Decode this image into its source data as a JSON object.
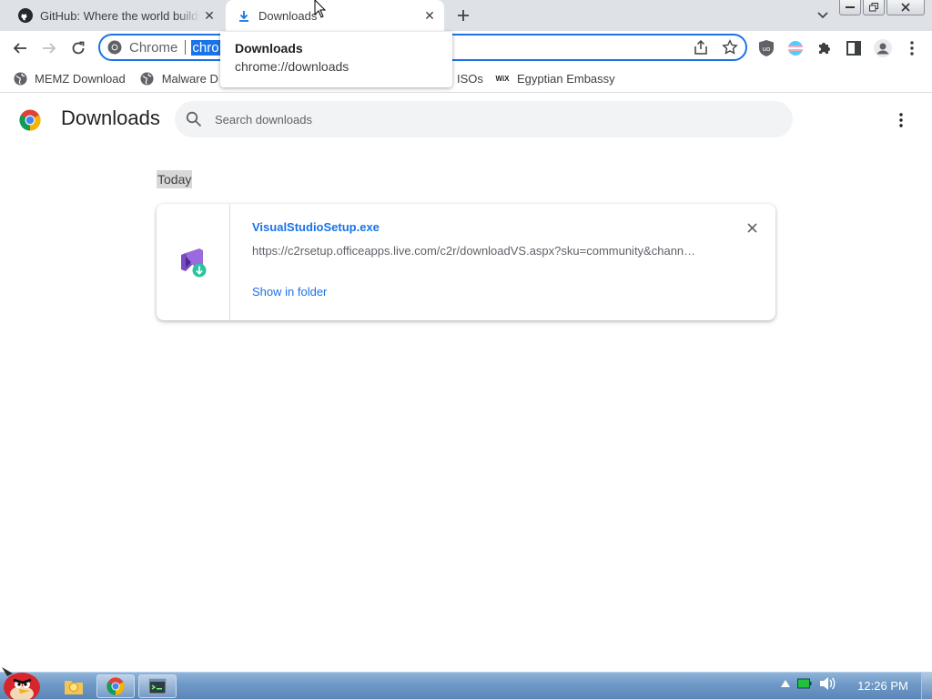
{
  "tabs": [
    {
      "title": "GitHub: Where the world builds software",
      "icon": "github-icon",
      "active": false
    },
    {
      "title": "Downloads",
      "icon": "download-icon",
      "active": true
    }
  ],
  "tab_hover_card": {
    "title": "Downloads",
    "url": "chrome://downloads"
  },
  "omnibox": {
    "chip_label": "Chrome",
    "url_text": "chrome://downloads",
    "url_visible": "chro"
  },
  "bookmarks": [
    {
      "label": "MEMZ Download",
      "icon": "globe-icon"
    },
    {
      "label": "Malware D",
      "icon": "globe-icon"
    },
    {
      "label": "ISOs",
      "icon": "globe-icon"
    },
    {
      "label": "Egyptian Embassy",
      "icon": "wix-icon"
    }
  ],
  "bookmark_wix_mark": "WiX",
  "page": {
    "title": "Downloads",
    "search_placeholder": "Search downloads",
    "section_label": "Today"
  },
  "downloads": [
    {
      "file_name": "VisualStudioSetup.exe",
      "url": "https://c2rsetup.officeapps.live.com/c2r/downloadVS.aspx?sku=community&chann…",
      "action_label": "Show in folder",
      "icon": "visual-studio-icon"
    }
  ],
  "taskbar": {
    "clock": "12:26 PM"
  },
  "colors": {
    "accent": "#1a73e8",
    "tabstrip": "#dee1e6",
    "search_bg": "#f1f3f4",
    "taskbar": "#6e98c6"
  }
}
